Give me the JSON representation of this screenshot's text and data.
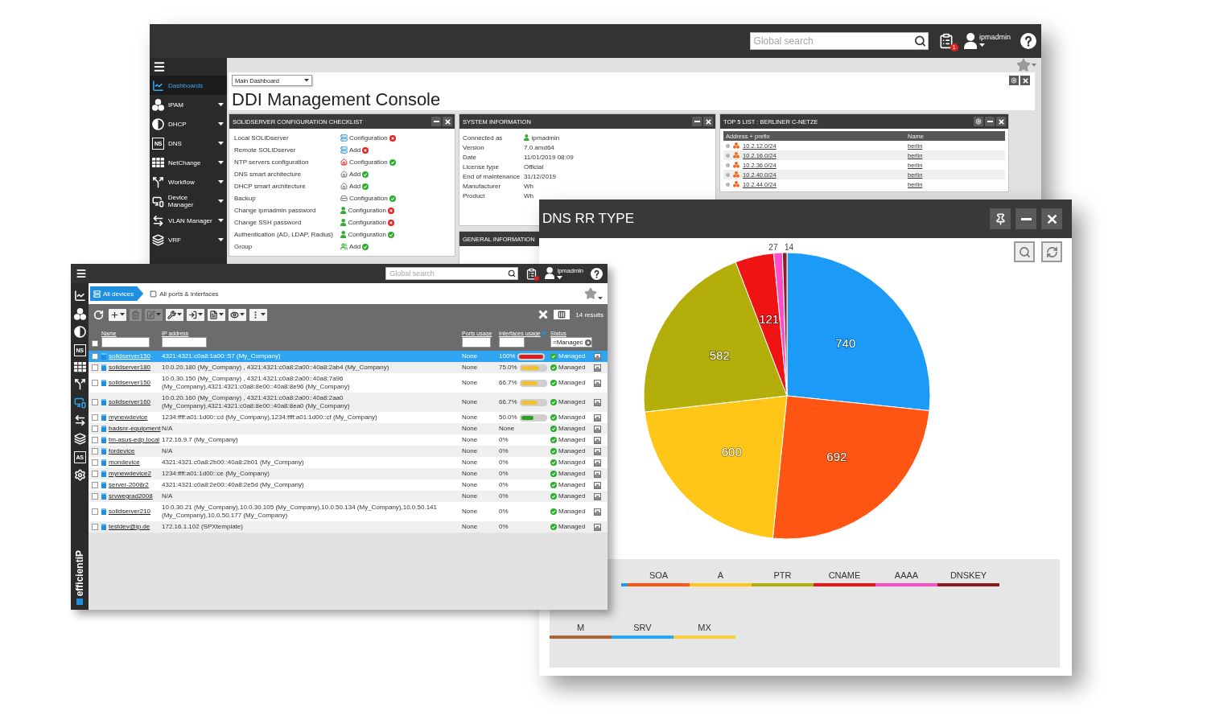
{
  "dashboard_window": {
    "top_bar": {
      "search": {
        "placeholder": "Global search"
      },
      "notification_count": "1",
      "user": "ipmadmin"
    },
    "sidebar": [
      {
        "label": "Dashboards",
        "kind": "dashboards",
        "selected": true,
        "submenu": false
      },
      {
        "label": "IPAM",
        "kind": "ipam",
        "selected": false,
        "submenu": true
      },
      {
        "label": "DHCP",
        "kind": "dhcp",
        "selected": false,
        "submenu": true
      },
      {
        "label": "DNS",
        "kind": "dns",
        "icon_text": "NS",
        "selected": false,
        "submenu": true
      },
      {
        "label": "NetChange",
        "kind": "netchange",
        "selected": false,
        "submenu": true
      },
      {
        "label": "Workflow",
        "kind": "workflow",
        "selected": false,
        "submenu": true
      },
      {
        "label": "Device Manager",
        "kind": "devices",
        "selected": false,
        "submenu": true
      },
      {
        "label": "VLAN Manager",
        "kind": "vlan",
        "selected": false,
        "submenu": true
      },
      {
        "label": "VRF",
        "kind": "vrf",
        "selected": false,
        "submenu": true
      }
    ],
    "dashboard_select": "Main Dashboard",
    "title": "DDI Management Console",
    "checklist": {
      "title": "SOLIDSERVER CONFIGURATION CHECKLIST",
      "items": [
        {
          "label": "Local SOLIDserver",
          "kind": "server",
          "action": "Configuration",
          "done": false
        },
        {
          "label": "Remote SOLIDserver",
          "kind": "server",
          "action": "Add",
          "done": false
        },
        {
          "label": "NTP servers configuration",
          "kind": "ntp",
          "action": "Configuration",
          "done": true
        },
        {
          "label": "DNS smart architecture",
          "kind": "architecture",
          "action": "Add",
          "done": true
        },
        {
          "label": "DHCP smart architecture",
          "kind": "architecture",
          "action": "Add",
          "done": true
        },
        {
          "label": "Backup",
          "kind": "backup",
          "action": "Configuration",
          "done": true
        },
        {
          "label": "Change ipmadmin password",
          "kind": "user",
          "action": "Configuration",
          "done": false
        },
        {
          "label": "Change SSH password",
          "kind": "user",
          "action": "Configuration",
          "done": false
        },
        {
          "label": "Authentication (AD, LDAP, Radius)",
          "kind": "user",
          "action": "Configuration",
          "done": true
        },
        {
          "label": "Group",
          "kind": "group",
          "action": "Add",
          "done": true
        }
      ]
    },
    "system_information": {
      "title": "SYSTEM INFORMATION",
      "rows": [
        {
          "label": "Connected as",
          "value": "ipmadmin",
          "kind": "user"
        },
        {
          "label": "Version",
          "value": "7.0 amd64",
          "kind": "text"
        },
        {
          "label": "Date",
          "value": "11/01/2019 08:09",
          "kind": "text"
        },
        {
          "label": "License type",
          "value": "Official",
          "kind": "text"
        },
        {
          "label": "End of maintenance",
          "value": "31/12/2019",
          "kind": "text"
        },
        {
          "label": "Manufacturer",
          "value": "Wh",
          "kind": "text"
        },
        {
          "label": "Product",
          "value": "Wh",
          "kind": "text"
        }
      ]
    },
    "general_information": {
      "title": "GENERAL INFORMATION"
    },
    "top5": {
      "title": "TOP 5 LIST : BERLINER C-NETZE",
      "columns": [
        "Address + prefix",
        "Name"
      ],
      "rows": [
        {
          "address": "10.2.12.0/24",
          "name": "berlin"
        },
        {
          "address": "10.2.16.0/24",
          "name": "berlin"
        },
        {
          "address": "10.2.36.0/24",
          "name": "berlin"
        },
        {
          "address": "10.2.40.0/24",
          "name": "berlin"
        },
        {
          "address": "10.2.44.0/24",
          "name": "berlin"
        }
      ]
    }
  },
  "devices_window": {
    "top_bar": {
      "search": {
        "placeholder": "Global search"
      },
      "unread": true,
      "user": "ipmadmin"
    },
    "sidebar": [
      {
        "kind": "dashboards",
        "selected": false
      },
      {
        "kind": "ipam",
        "selected": false
      },
      {
        "kind": "dhcp",
        "selected": false
      },
      {
        "kind": "dns",
        "icon_text": "NS",
        "selected": false
      },
      {
        "kind": "netchange",
        "selected": false
      },
      {
        "kind": "workflow",
        "selected": false
      },
      {
        "kind": "devices",
        "selected": true
      },
      {
        "kind": "vlan",
        "selected": false
      },
      {
        "kind": "vrf",
        "selected": false
      },
      {
        "kind": "as",
        "icon_text": "AS",
        "selected": false
      },
      {
        "kind": "settings",
        "selected": false
      }
    ],
    "logo": "efficientiP",
    "tabs": [
      {
        "label": "All devices",
        "kind": "devices",
        "selected": true
      },
      {
        "label": "All ports & interfaces",
        "kind": "ports",
        "selected": false
      }
    ],
    "toolbar": [
      {
        "kind": "refresh",
        "disabled": false,
        "menu": false
      },
      {
        "kind": "add",
        "disabled": false,
        "menu": true
      },
      {
        "kind": "delete",
        "disabled": true,
        "menu": false
      },
      {
        "kind": "edit",
        "disabled": true,
        "menu": true
      },
      {
        "kind": "tools",
        "disabled": false,
        "menu": true
      },
      {
        "kind": "import",
        "disabled": false,
        "menu": true
      },
      {
        "kind": "report",
        "disabled": false,
        "menu": true
      },
      {
        "kind": "view",
        "disabled": false,
        "menu": true
      },
      {
        "kind": "more",
        "disabled": false,
        "menu": true
      }
    ],
    "results": "14 results",
    "all_checked": false,
    "columns": [
      {
        "label": "Name",
        "sorted": false
      },
      {
        "label": "IP address",
        "sorted": false
      },
      {
        "label": "Ports usage",
        "sorted": false
      },
      {
        "label": "Interfaces usage",
        "sorted": true
      },
      {
        "label": "Status",
        "sorted": false,
        "filter": "=Managed"
      }
    ],
    "rows": [
      {
        "name": "solidserver150",
        "ip": "4321:4321:c0a8:1a00::57 (My_Company)",
        "ports": "None",
        "interfaces": "100%",
        "level": 1,
        "status": "Managed",
        "selected": true,
        "checked": false
      },
      {
        "name": "solidserver180",
        "ip": "10.0.20.180 (My_Company) , 4321:4321:c0a8:2a00::40a8:2ab4 (My_Company)",
        "ports": "None",
        "interfaces": "75.0%",
        "level": 0.75,
        "status": "Managed",
        "selected": false,
        "checked": false
      },
      {
        "name": "solidserver150",
        "ip": "10.0.30.150 (My_Company) , 4321:4321:c0a8:2a00::40a8:7a96 (My_Company),4321:4321:c0a8:8e00::40a8:8e96 (My_Company)",
        "ports": "None",
        "interfaces": "66.7%",
        "level": 0.667,
        "status": "Managed",
        "selected": false,
        "checked": false
      },
      {
        "name": "solidserver160",
        "ip": "10.0.20.160 (My_Company) , 4321:4321:c0a8:2a00::40a8:2aa0 (My_Company),4321:4321:c0a8:8e00::40a8:8ea0 (My_Company)",
        "ports": "None",
        "interfaces": "66.7%",
        "level": 0.667,
        "status": "Managed",
        "selected": false,
        "checked": false
      },
      {
        "name": "mynewdevice",
        "ip": "1234:ffff:a01:1d00::cd (My_Company),1234:ffff:a01:1d00::cf (My_Company)",
        "ports": "None",
        "interfaces": "50.0%",
        "level": 0.5,
        "status": "Managed",
        "selected": false,
        "checked": false
      },
      {
        "name": "badsnr-equipment",
        "ip": "N/A",
        "ports": "None",
        "interfaces": "None",
        "status": "Managed",
        "selected": false,
        "checked": false
      },
      {
        "name": "tm-asus-edp.local",
        "ip": "172.16.9.7 (My_Company)",
        "ports": "None",
        "interfaces": "0%",
        "status": "Managed",
        "selected": false,
        "checked": false
      },
      {
        "name": "fordevice",
        "ip": "N/A",
        "ports": "None",
        "interfaces": "0%",
        "status": "Managed",
        "selected": false,
        "checked": false
      },
      {
        "name": "mondevice",
        "ip": "4321:4321:c0a8:2b00::40a8:2b01 (My_Company)",
        "ports": "None",
        "interfaces": "0%",
        "status": "Managed",
        "selected": false,
        "checked": false
      },
      {
        "name": "mynewdevice2",
        "ip": "1234:ffff:a01:1d00::ce (My_Company)",
        "ports": "None",
        "interfaces": "0%",
        "status": "Managed",
        "selected": false,
        "checked": false
      },
      {
        "name": "server-2008r2",
        "ip": "4321:4321:c0a8:2e00::40a8:2e5d (My_Company)",
        "ports": "None",
        "interfaces": "0%",
        "status": "Managed",
        "selected": false,
        "checked": false
      },
      {
        "name": "srvwegrad2008",
        "ip": "N/A",
        "ports": "None",
        "interfaces": "0%",
        "status": "Managed",
        "selected": false,
        "checked": false
      },
      {
        "name": "solidserver210",
        "ip": "10.0.30.21 (My_Company),10.0.30.105 (My_Company),10.0.50.134 (My_Company),10.0.50.141 (My_Company),10.0.50.177 (My_Company)",
        "ports": "None",
        "interfaces": "0%",
        "status": "Managed",
        "selected": false,
        "checked": false
      },
      {
        "name": "testdev@ip.de",
        "ip": "172.16.1.102 (SPXtemplate)",
        "ports": "None",
        "interfaces": "0%",
        "status": "Managed",
        "selected": false,
        "checked": false
      }
    ]
  },
  "chart_window": {
    "title": "DNS RR TYPE",
    "buttons": [
      {
        "kind": "pin"
      },
      {
        "kind": "minimize"
      },
      {
        "kind": "close"
      }
    ],
    "tools": [
      {
        "kind": "zoom"
      },
      {
        "kind": "refresh"
      }
    ],
    "chart_data": {
      "type": "pie",
      "values": [
        740,
        692,
        600,
        582,
        121,
        27,
        14
      ],
      "data_labels": true
    },
    "legend": [
      {
        "color": "#1b9bf7"
      },
      {
        "label": "SOA",
        "color": "#ff5512"
      },
      {
        "label": "A",
        "color": "#ffc617"
      },
      {
        "label": "PTR",
        "color": "#b4ae0b"
      },
      {
        "label": "CNAME",
        "color": "#ef1313"
      },
      {
        "label": "AAAA",
        "color": "#ff4fc8"
      },
      {
        "label": "DNSKEY",
        "color": "#8e1c1c"
      },
      {
        "label": "M",
        "color": "#a8643c"
      },
      {
        "label": "SRV",
        "color": "#2aa7f2"
      },
      {
        "label": "MX",
        "color": "#f4d03f"
      }
    ]
  }
}
